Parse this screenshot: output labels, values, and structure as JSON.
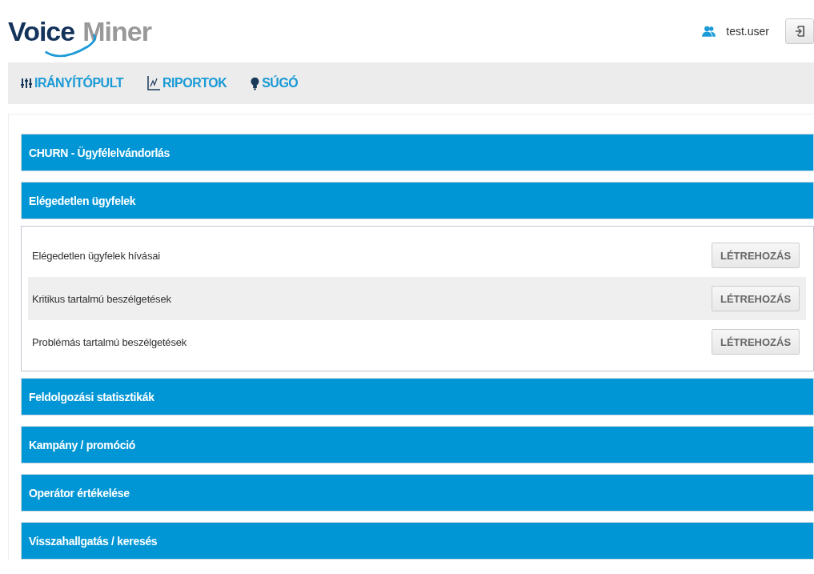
{
  "logo": {
    "first": "Voice",
    "second": "Miner"
  },
  "user": {
    "name": "test.user"
  },
  "nav": [
    {
      "label": "IRÁNYÍTÓPULT",
      "kind": "sliders"
    },
    {
      "label": "RIPORTOK",
      "kind": "chart"
    },
    {
      "label": "SÚGÓ",
      "kind": "bulb"
    }
  ],
  "sections": [
    {
      "title": "CHURN - Ügyfélelvándorlás"
    },
    {
      "title": "Elégedetlen ügyfelek",
      "items": [
        {
          "label": "Elégedetlen ügyfelek hívásai",
          "button": "LÉTREHOZÁS"
        },
        {
          "label": "Kritikus tartalmú beszélgetések",
          "button": "LÉTREHOZÁS"
        },
        {
          "label": "Problémás tartalmú beszélgetések",
          "button": "LÉTREHOZÁS"
        }
      ]
    },
    {
      "title": "Feldolgozási statisztikák"
    },
    {
      "title": "Kampány / promóció"
    },
    {
      "title": "Operátor értékelése"
    },
    {
      "title": "Visszahallgatás / keresés"
    }
  ]
}
